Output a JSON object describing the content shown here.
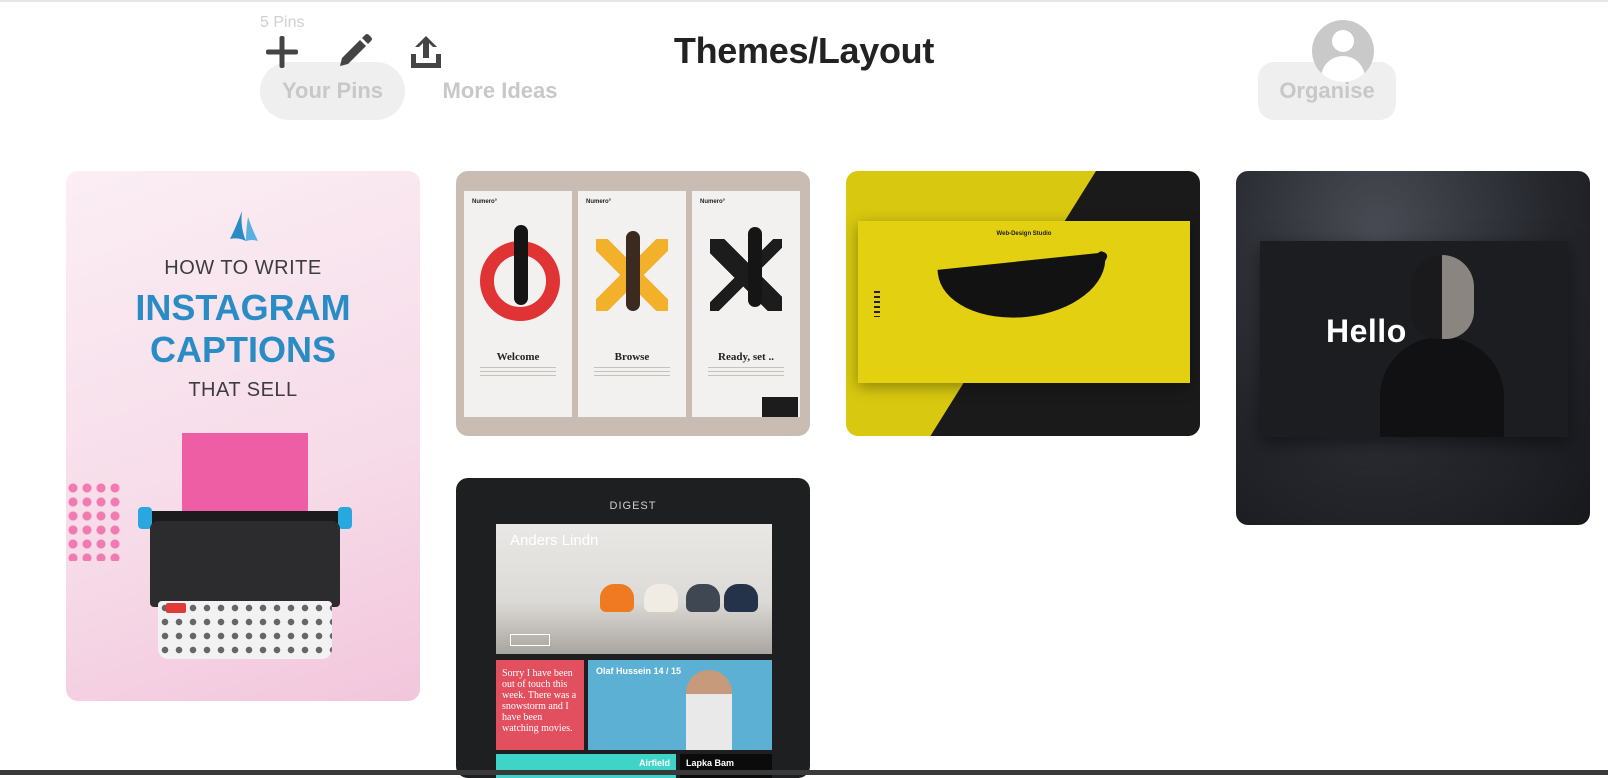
{
  "board": {
    "pin_count": "5 Pins",
    "title": "Themes/Layout"
  },
  "tabs": [
    {
      "label": "Your Pins",
      "active": true
    },
    {
      "label": "More Ideas",
      "active": false
    }
  ],
  "organise_label": "Organise",
  "toolbar": {
    "add_icon": "plus-icon",
    "edit_icon": "pencil-icon",
    "share_icon": "upload-icon",
    "avatar_icon": "default-user-avatar"
  },
  "pins": {
    "instagram": {
      "line1": "HOW TO WRITE",
      "line2": "INSTAGRAM",
      "line3": "CAPTIONS",
      "line4": "THAT SELL"
    },
    "numero": {
      "screens": [
        {
          "brand": "Numero°",
          "title": "Welcome"
        },
        {
          "brand": "Numero°",
          "title": "Browse"
        },
        {
          "brand": "Numero°",
          "title": "Ready, set .."
        }
      ]
    },
    "banana": {
      "studio": "Web-Design Studio"
    },
    "hello": {
      "headline": "Hello"
    },
    "digest": {
      "brand": "DIGEST",
      "hero_title": "Anders Lindn",
      "red_card_text": "Sorry I have been out of touch this week. There was a snowstorm and I have been watching movies.",
      "blue_card_title": "Olaf Hussein 14 / 15",
      "teal_label": "Airfield",
      "dark_label": "Lapka Bam"
    }
  },
  "colors": {
    "accent_blue": "#2a8cc4",
    "banana_yellow": "#e2d011",
    "text_dark": "#222222"
  }
}
